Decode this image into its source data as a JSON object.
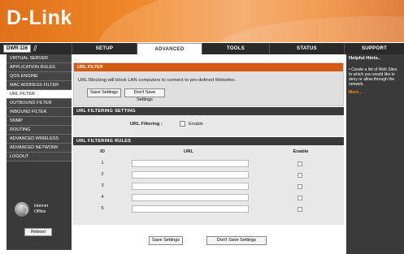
{
  "brand": {
    "logo": "D-Link"
  },
  "nav": {
    "model": "DWR-116",
    "tabs": [
      "SETUP",
      "ADVANCED",
      "TOOLS",
      "STATUS",
      "SUPPORT"
    ]
  },
  "sidebar": {
    "items": [
      "VIRTUAL SERVER",
      "APPLICATION RULES",
      "QOS ENGINE",
      "MAC ADDRESS FILTER",
      "URL FILTER",
      "OUTBOUND FILTER",
      "INBOUND FILTER",
      "SNMP",
      "ROUTING",
      "ADVANCED WIRELESS",
      "ADVANCED NETWORK",
      "LOGOUT"
    ],
    "internet_label": "Internet",
    "internet_status": "Offline",
    "reboot_label": "Reboot"
  },
  "url_filter": {
    "title": "URL FILTER",
    "description": "URL Blocking will block LAN computers to connect to pre-defined Websites.",
    "save_label": "Save Settings",
    "nosave_label": "Don't Save Settings"
  },
  "setting": {
    "title": "URL FILTERING SETTING",
    "label": "URL Filtering :",
    "enable_label": "Enable"
  },
  "rules": {
    "title": "URL FILTERING RULES",
    "headers": {
      "id": "ID",
      "url": "URL",
      "enable": "Enable"
    },
    "rows": [
      "1",
      "2",
      "3",
      "4",
      "5"
    ]
  },
  "bottom": {
    "save_label": "Save Settings",
    "nosave_label": "Don't Save Settings"
  },
  "help": {
    "title": "Helpful Hints..",
    "text": "• Create a list of Web Sites to which you would like to deny or allow through the network.",
    "more": "More..."
  }
}
